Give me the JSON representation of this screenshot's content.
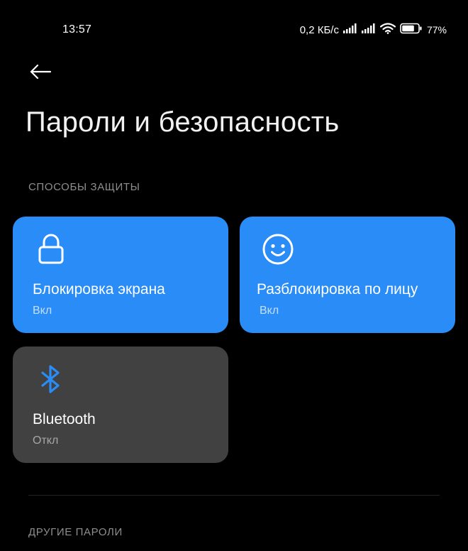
{
  "status_bar": {
    "time": "13:57",
    "network_speed": "0,2 КБ/с",
    "battery_percent": "77%",
    "battery_level": 0.77,
    "icons": [
      "signal-icon",
      "signal-icon",
      "wifi-icon",
      "battery-icon"
    ]
  },
  "header": {
    "back_icon": "arrow-left-icon",
    "title": "Пароли и безопасность"
  },
  "sections": {
    "protection": {
      "label": "СПОСОБЫ ЗАЩИТЫ",
      "tiles": [
        {
          "title": "Блокировка экрана",
          "status": "Вкл",
          "icon": "lock-icon",
          "color": "#2a8cf6"
        },
        {
          "title": "Разблокировка по лицу",
          "status": "Вкл",
          "icon": "smiley-face-icon",
          "color": "#2a8cf6"
        },
        {
          "title": "Bluetooth",
          "status": "Откл",
          "icon": "bluetooth-icon",
          "color": "#414141",
          "icon_color": "#2a8cf6"
        }
      ]
    },
    "other": {
      "label": "ДРУГИЕ ПАРОЛИ"
    }
  },
  "colors": {
    "background": "#000000",
    "accent": "#2a8cf6",
    "tile_inactive": "#414141",
    "section_label": "#8e8e8e"
  }
}
